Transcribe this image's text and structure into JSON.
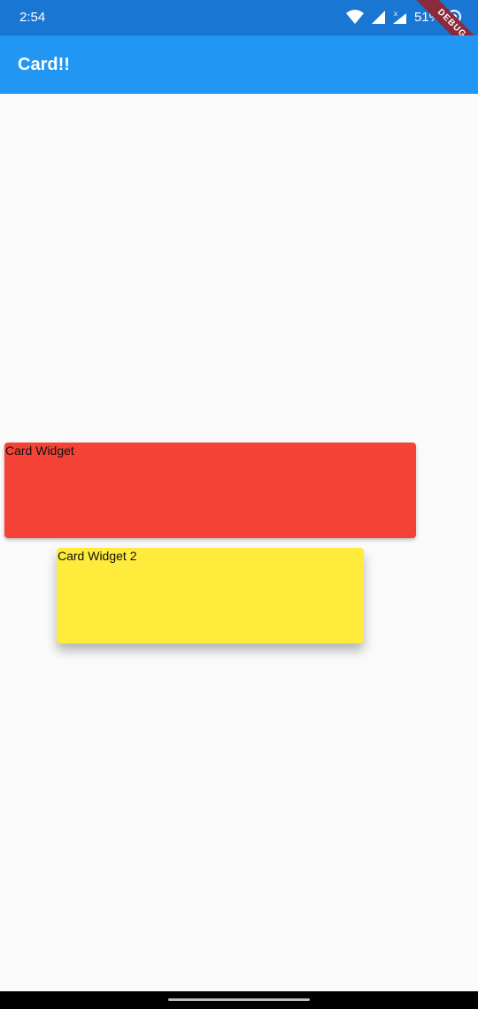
{
  "status_bar": {
    "time": "2:54",
    "battery": "51%",
    "icons": [
      "wifi-icon",
      "signal-icon",
      "signal-no-data-icon",
      "battery-icon"
    ]
  },
  "app_bar": {
    "title": "Card!!",
    "background": "#2196f3"
  },
  "debug_banner": {
    "label": "DEBUG",
    "color": "#8b2a3c"
  },
  "cards": [
    {
      "label": "Card Widget",
      "color": "#f44336"
    },
    {
      "label": "Card Widget 2",
      "color": "#ffeb3b"
    }
  ]
}
